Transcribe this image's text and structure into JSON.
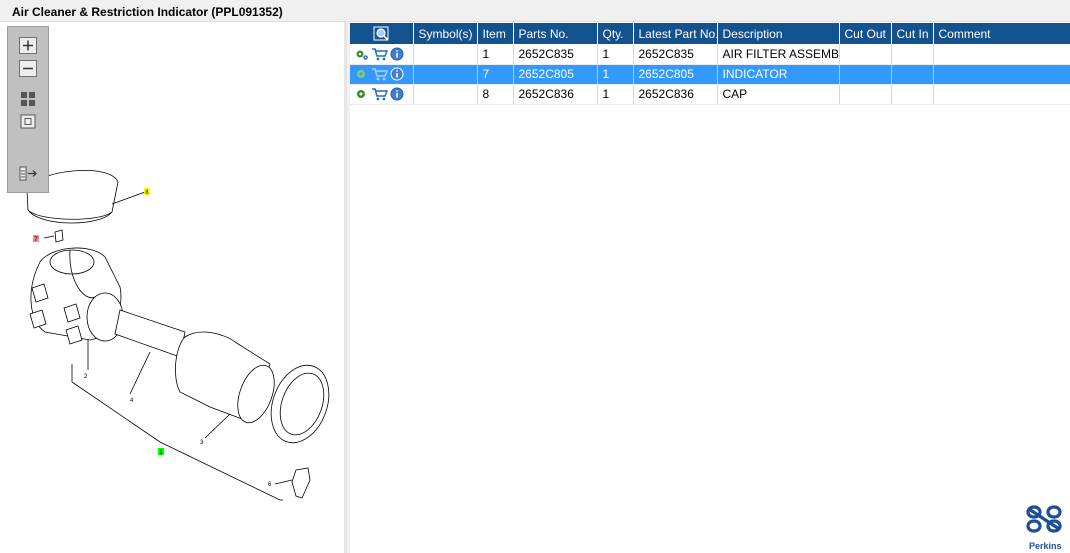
{
  "window": {
    "title": "Air Cleaner & Restriction Indicator (PPL091352)"
  },
  "toolbar": {
    "zoom_in": "zoom-in-icon",
    "zoom_out": "zoom-out-icon",
    "fit_all": "fit-all-icon",
    "fit_window": "fit-window-icon",
    "export": "export-list-icon"
  },
  "diagram": {
    "callouts": {
      "c8": "8",
      "c7": "7",
      "c1": "1",
      "c2": "2",
      "c3": "3",
      "c4": "4",
      "c6": "6"
    },
    "colors": {
      "highlight_yellow": "#ffff00",
      "highlight_red": "#ff8080",
      "highlight_green": "#00ff00"
    }
  },
  "grid": {
    "columns": [
      "",
      "Symbol(s)",
      "Item",
      "Parts No.",
      "Qty.",
      "Latest Part No.",
      "Description",
      "Cut Out",
      "Cut In",
      "Comment"
    ],
    "rows": [
      {
        "symbols": "",
        "item": "1",
        "part_no": "2652C835",
        "qty": "1",
        "latest_part_no": "2652C835",
        "description": "AIR FILTER ASSEMBLY",
        "cut_out": "",
        "cut_in": "",
        "comment": ""
      },
      {
        "symbols": "",
        "item": "7",
        "part_no": "2652C805",
        "qty": "1",
        "latest_part_no": "2652C805",
        "description": "INDICATOR",
        "cut_out": "",
        "cut_in": "",
        "comment": ""
      },
      {
        "symbols": "",
        "item": "8",
        "part_no": "2652C836",
        "qty": "1",
        "latest_part_no": "2652C836",
        "description": "CAP",
        "cut_out": "",
        "cut_in": "",
        "comment": ""
      }
    ],
    "selected_row": 1,
    "header_color": "#14528f",
    "selected_color": "#3399ff"
  },
  "brand": {
    "name": "Perkins",
    "color": "#1c4f9a"
  }
}
